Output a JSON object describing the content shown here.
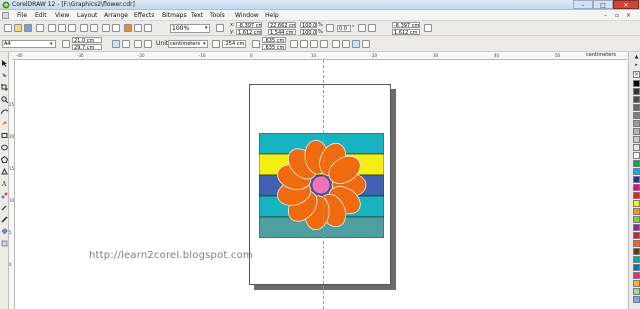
{
  "window": {
    "title": "CorelDRAW 12 - [F:\\Graphics2\\flower.cdr]",
    "minimize_glyph": "–",
    "maximize_glyph": "□",
    "close_glyph": "✕"
  },
  "menu": [
    "File",
    "Edit",
    "View",
    "Layout",
    "Arrange",
    "Effects",
    "Bitmaps",
    "Text",
    "Tools",
    "Window",
    "Help"
  ],
  "standard_toolbar": {
    "zoom": "100%"
  },
  "object_fields": {
    "x": "-8.397 cm",
    "y": "1.612 cm",
    "width": "22.662 cm",
    "height": "1.544 cm",
    "scale_w": "100.0",
    "scale_h": "100.0",
    "percent_w": "%",
    "percent_h": "%",
    "angle": "0.0",
    "angle_unit": "°",
    "pos_x2": "-8.397 cm",
    "pos_y2": "1.612 cm"
  },
  "property_bar": {
    "paper_size": "A4",
    "page_width": "21.0 cm",
    "page_height": "29.7 cm",
    "units_label": "Units:",
    "units_value": "centimeters",
    "nudge": ".254 cm",
    "dup_x": ".635 cm",
    "dup_y": ".635 cm"
  },
  "ruler": {
    "units": "centimeters",
    "top_labels": [
      "-40",
      "-30",
      "-20",
      "-10",
      "0",
      "10",
      "20",
      "30",
      "40",
      "50"
    ],
    "left_labels": [
      "25",
      "20",
      "15",
      "10",
      "5",
      "0"
    ]
  },
  "watermark": "http://learn2corel.blogspot.com",
  "colors": {
    "band_1": "#17b3c1",
    "band_2": "#f3ef13",
    "band_3": "#3f62b0",
    "band_4": "#17b3c1",
    "band_5": "#4ea0a0",
    "petal": "#f06a0f",
    "center": "#ef73b6",
    "palette": [
      "#000000",
      "#333333",
      "#4d4d4d",
      "#666666",
      "#808080",
      "#999999",
      "#b3b3b3",
      "#cccccc",
      "#e6e6e6",
      "#ffffff",
      "#00a651",
      "#00aeef",
      "#2e3192",
      "#ec008c",
      "#ed1c24",
      "#fff200",
      "#f7941d",
      "#8dc63f",
      "#92278f",
      "#c1272d",
      "#f26522",
      "#603913",
      "#00a99d",
      "#0072bc",
      "#ee2a7b",
      "#fbb040",
      "#a3d39c",
      "#7da7d9"
    ]
  },
  "icons": {
    "toolbox": [
      "pick-tool-icon",
      "shape-tool-icon",
      "crop-tool-icon",
      "zoom-tool-icon",
      "freehand-tool-icon",
      "smart-fill-icon",
      "rectangle-tool-icon",
      "ellipse-tool-icon",
      "polygon-tool-icon",
      "basic-shapes-icon",
      "text-tool-icon",
      "interactive-blend-icon",
      "eyedropper-icon",
      "outline-tool-icon",
      "fill-tool-icon",
      "interactive-fill-icon"
    ]
  }
}
